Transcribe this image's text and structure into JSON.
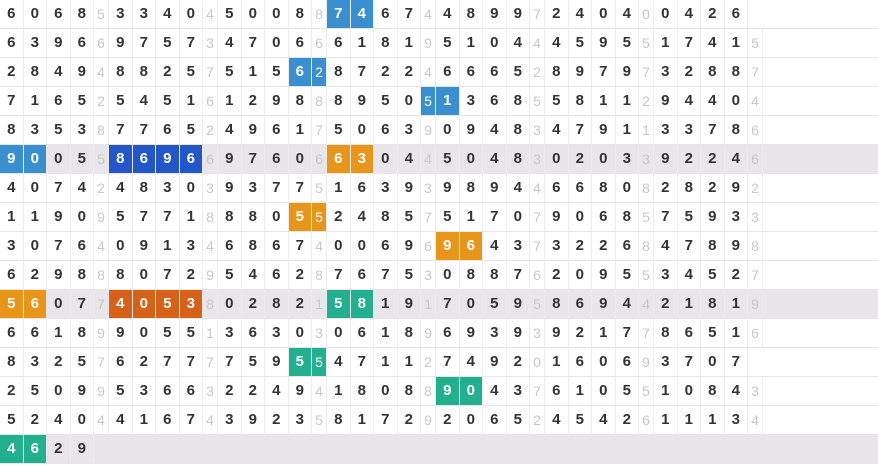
{
  "rows": [
    "6068533404500887467448997240400426",
    "6396697573470666181951044459551741 5",
    "2849488257515628722466652897973288 7",
    "7165254516129888950513685581129440 4",
    "8353877652496175063909483479113378 6",
    "9005586966976066304450483020339224 6",
    "4074248303937751639398944668082829 2",
    "1190957718880552485751707906857593 3",
    "3076409134686740069696437322684789 8",
    "6298880729546287675308876209553452 7",
    "5607740538028215819170595869442181 9",
    "6618990551363030618969393921778651 6",
    "8325762777759554711274920160693707",
    "2509953663224941808890437610551084 3",
    "5240441674392358172920652454261113 4",
    "4629"
  ],
  "highlights": [
    {
      "row": 0,
      "cols": [
        15,
        16
      ],
      "color": "#3a8fd0"
    },
    {
      "row": 2,
      "cols": [
        13,
        14
      ],
      "color": "#3a8fd0"
    },
    {
      "row": 3,
      "cols": [
        19,
        20
      ],
      "color": "#3a8fd0"
    },
    {
      "row": 5,
      "cols": [
        0,
        1
      ],
      "color": "#3a8fd0"
    },
    {
      "row": 5,
      "cols": [
        5,
        6,
        7,
        8
      ],
      "color": "#2356c9"
    },
    {
      "row": 5,
      "cols": [
        15,
        16
      ],
      "color": "#e8961a"
    },
    {
      "row": 7,
      "cols": [
        13,
        14
      ],
      "color": "#e8961a"
    },
    {
      "row": 8,
      "cols": [
        20,
        21
      ],
      "color": "#e8961a"
    },
    {
      "row": 10,
      "cols": [
        0,
        1
      ],
      "color": "#e8961a"
    },
    {
      "row": 10,
      "cols": [
        5,
        6,
        7,
        8
      ],
      "color": "#d6621a"
    },
    {
      "row": 10,
      "cols": [
        15,
        16
      ],
      "color": "#23b08f"
    },
    {
      "row": 12,
      "cols": [
        13,
        14
      ],
      "color": "#23b08f"
    },
    {
      "row": 13,
      "cols": [
        20,
        21
      ],
      "color": "#23b08f"
    },
    {
      "row": 15,
      "cols": [
        0,
        1
      ],
      "color": "#23b08f"
    },
    {
      "row": 15,
      "cols": [
        5,
        6,
        7,
        8
      ],
      "color": "#1f9a45"
    }
  ],
  "colors": {
    "separator_text": "#c8c8c8",
    "digit_text": "#333333",
    "alt_row_bg": "#e8e6ea"
  }
}
